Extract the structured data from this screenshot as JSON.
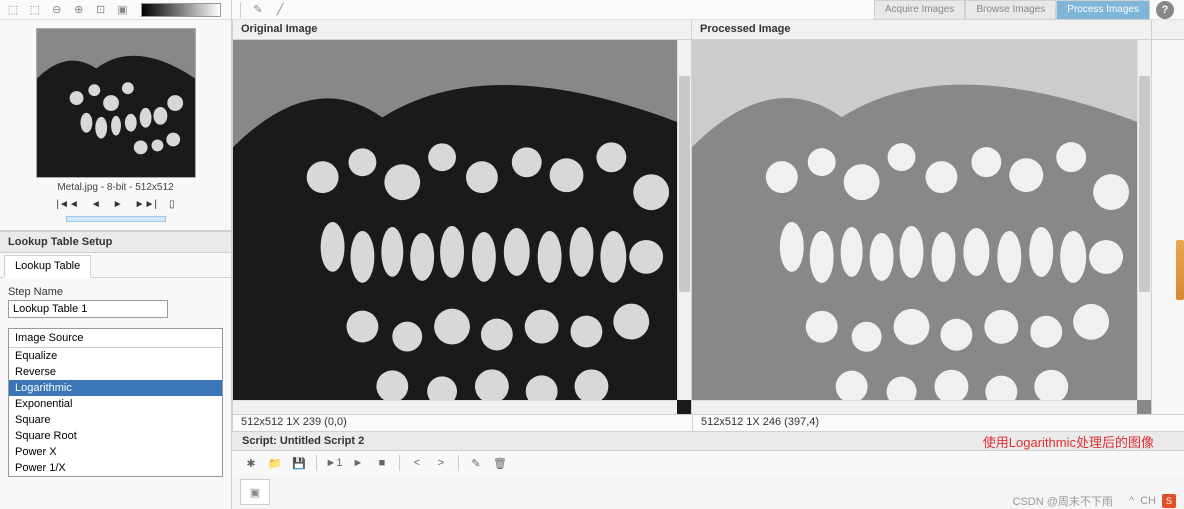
{
  "top_tabs": {
    "acquire": "Acquire Images",
    "browse": "Browse Images",
    "process": "Process Images"
  },
  "toolbar": {
    "help": "?"
  },
  "thumbnail": {
    "caption": "Metal.jpg - 8-bit - 512x512"
  },
  "sections": {
    "lookup_setup": "Lookup Table Setup",
    "lookup_tab": "Lookup Table"
  },
  "form": {
    "step_name_label": "Step Name",
    "step_name_value": "Lookup Table 1",
    "image_source_label": "Image Source"
  },
  "lookup_options": [
    "Equalize",
    "Reverse",
    "Logarithmic",
    "Exponential",
    "Square",
    "Square Root",
    "Power X",
    "Power 1/X"
  ],
  "selected_option_index": 2,
  "image_headers": {
    "original": "Original Image",
    "processed": "Processed Image"
  },
  "info": {
    "original": "512x512 1X 239    (0,0)",
    "processed": "512x512 1X 246    (397,4)"
  },
  "script": {
    "title": "Script: Untitled Script 2",
    "annotation": "使用Logarithmic处理后的图像"
  },
  "watermark": "CSDN @周末不下雨",
  "footer": {
    "ime": "CH"
  }
}
